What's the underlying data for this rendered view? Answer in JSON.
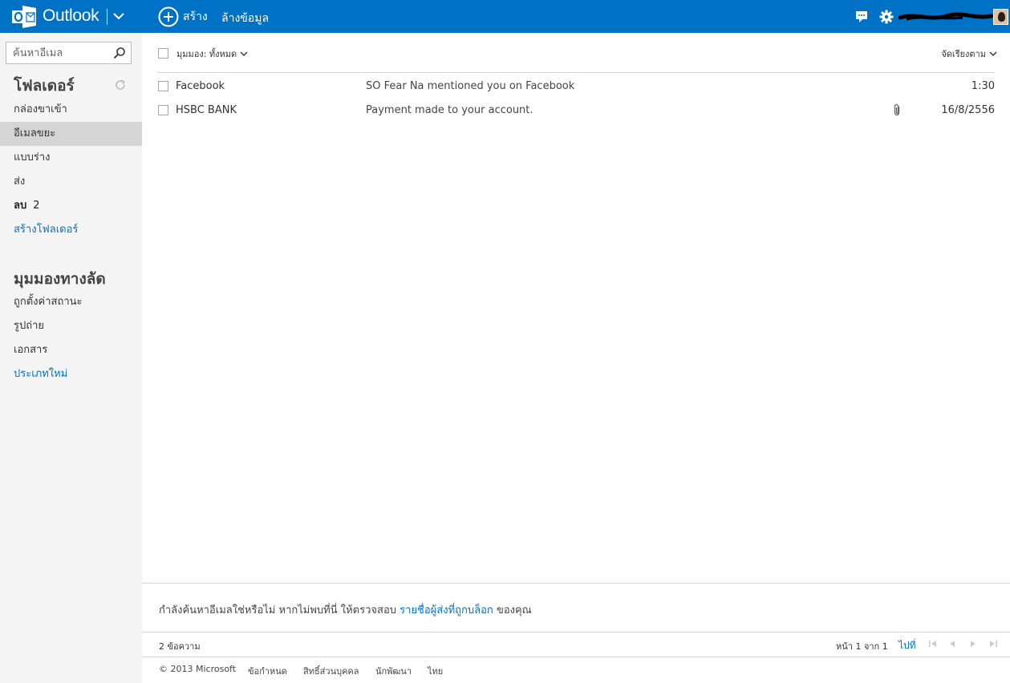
{
  "header": {
    "app_name": "Outlook",
    "new_label": "สร้าง",
    "clear_label": "ล้างข้อมูล",
    "accent_color": "#0072C6"
  },
  "sidebar": {
    "search_placeholder": "ค้นหาอีเมล",
    "folders_heading": "โฟลเดอร์",
    "folders": [
      {
        "label": "กล่องขาเข้า"
      },
      {
        "label": "อีเมลขยะ"
      },
      {
        "label": "แบบร่าง"
      },
      {
        "label": "ส่ง"
      },
      {
        "label": "ลบ",
        "count": "2"
      },
      {
        "label": "สร้างโฟลเดอร์"
      }
    ],
    "quick_views_heading": "มุมมองทางลัด",
    "quick_views": [
      {
        "label": "ถูกตั้งค่าสถานะ"
      },
      {
        "label": "รูปถ่าย"
      },
      {
        "label": "เอกสาร"
      },
      {
        "label": "ประเภทใหม่"
      }
    ]
  },
  "list": {
    "view_label": "มุมมอง: ทั้งหมด",
    "sort_label": "จัดเรียงตาม",
    "messages": [
      {
        "from": "Facebook",
        "subject": "SO Fear Na mentioned you on Facebook",
        "date": "1:30",
        "attachment": false
      },
      {
        "from": "HSBC BANK",
        "subject": "Payment made to your account.",
        "date": "16/8/2556",
        "attachment": true
      }
    ]
  },
  "notice": {
    "prefix": "กำลังค้นหาอีเมลใช่หรือไม่ หากไม่พบที่นี่ ให้ตรวจสอบ",
    "link": "รายชื่อผู้ส่งที่ถูกบล็อก",
    "suffix": "ของคุณ"
  },
  "pager": {
    "count_label": "2 ข้อความ",
    "page_label": "หน้า 1 จาก 1",
    "goto_label": "ไปที่"
  },
  "footer": {
    "copyright": "© 2013 Microsoft",
    "terms": "ข้อกำหนด",
    "privacy": "สิทธิ์ส่วนบุคคล",
    "developers": "นักพัฒนา",
    "language": "ไทย"
  }
}
